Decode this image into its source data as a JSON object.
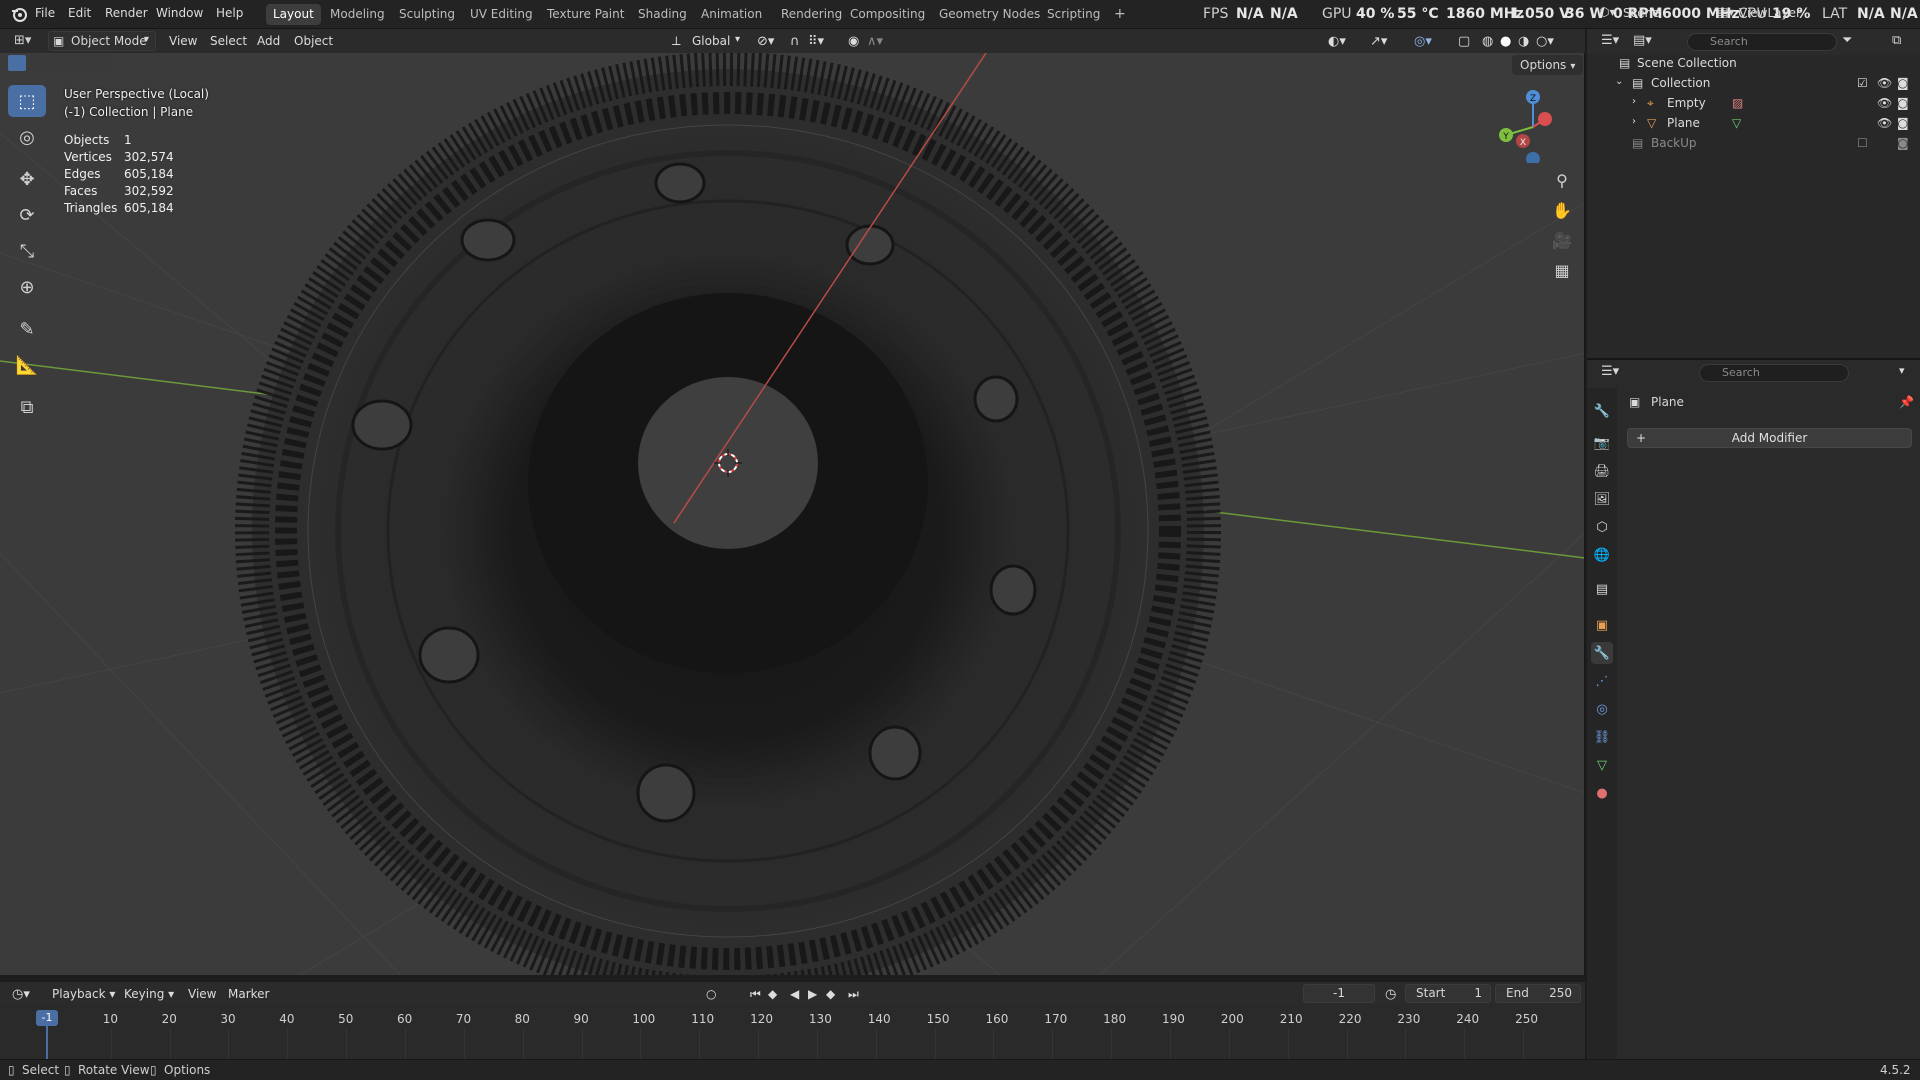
{
  "menu": {
    "file": "File",
    "edit": "Edit",
    "render": "Render",
    "window": "Window",
    "help": "Help"
  },
  "workspaces": [
    "Layout",
    "Modeling",
    "Sculpting",
    "UV Editing",
    "Texture Paint",
    "Shading",
    "Animation",
    "Rendering",
    "Compositing",
    "Geometry Nodes",
    "Scripting"
  ],
  "add_tab": "+",
  "perf": {
    "fps_label": "FPS",
    "fps_value1": "N/A",
    "fps_value2": "N/A",
    "gpu_label": "GPU",
    "gpu_load": "40 %",
    "gpu_temp": "55 °C",
    "gpu_clock": "1860 MHz",
    "gpu_volt": "1.050 V",
    "gpu_power": "36 W",
    "gpu_fan": "0 RPM",
    "gpu_mem": "6000 MHz",
    "cpu_label": "CPU",
    "cpu_load": "19 %",
    "lat_label": "LAT",
    "lat_value1": "N/A",
    "lat_value2": "N/A"
  },
  "scene": {
    "scene_name": "Scene",
    "view_layer": "ViewLayer"
  },
  "viewport_header": {
    "mode": "Object Mode",
    "view": "View",
    "select": "Select",
    "add": "Add",
    "object": "Object",
    "orientation": "Global",
    "options": "Options"
  },
  "viewport_overlay": {
    "perspective": "User Perspective (Local)",
    "collection_line": "(-1) Collection | Plane",
    "stats": [
      {
        "k": "Objects",
        "v": "1"
      },
      {
        "k": "Vertices",
        "v": "302,574"
      },
      {
        "k": "Edges",
        "v": "605,184"
      },
      {
        "k": "Faces",
        "v": "302,592"
      },
      {
        "k": "Triangles",
        "v": "605,184"
      }
    ]
  },
  "gizmo": {
    "z": "Z",
    "y": "Y",
    "x": "X"
  },
  "outliner": {
    "search_placeholder": "Search",
    "items": [
      {
        "label": "Scene Collection"
      },
      {
        "label": "Collection"
      },
      {
        "label": "Empty"
      },
      {
        "label": "Plane"
      },
      {
        "label": "BackUp"
      }
    ]
  },
  "properties": {
    "search_placeholder": "Search",
    "object_name": "Plane",
    "add_modifier": "Add Modifier"
  },
  "timeline": {
    "playback": "Playback",
    "keying": "Keying",
    "view": "View",
    "marker": "Marker",
    "current_frame": "-1",
    "start_label": "Start",
    "start_value": "1",
    "end_label": "End",
    "end_value": "250",
    "playhead": "-1",
    "ticks": [
      "10",
      "20",
      "30",
      "40",
      "50",
      "60",
      "70",
      "80",
      "90",
      "100",
      "110",
      "120",
      "130",
      "140",
      "150",
      "160",
      "170",
      "180",
      "190",
      "200",
      "210",
      "220",
      "230",
      "240",
      "250"
    ]
  },
  "statusbar": {
    "select": "Select",
    "rotate": "Rotate View",
    "options": "Options",
    "version": "4.5.2"
  },
  "colors": {
    "accent": "#4a6fa5",
    "x_axis": "#d94f4f",
    "y_axis": "#7fbf3f",
    "z_axis": "#4f8fd9"
  }
}
